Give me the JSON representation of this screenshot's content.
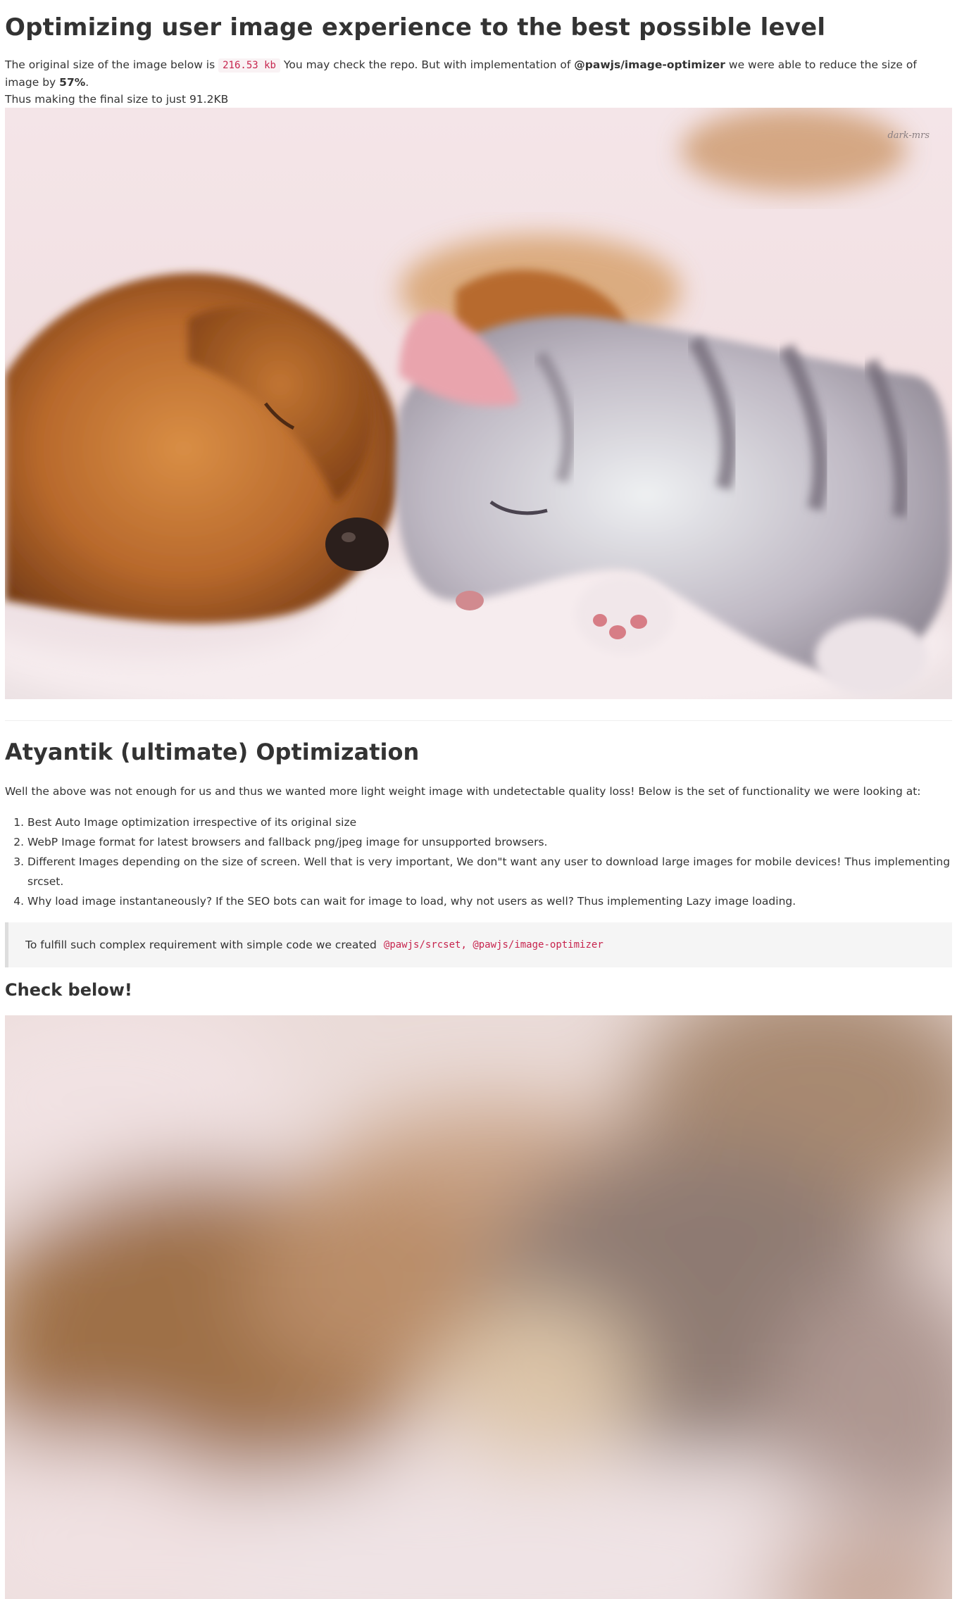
{
  "header": {
    "title": "Optimizing user image experience to the best possible level"
  },
  "intro": {
    "part1": "The original size of the image below is",
    "original_size": "216.53 kb",
    "part2": "You may check the repo. But with implementation of",
    "package": "@pawjs/image-optimizer",
    "part3": "we were able to reduce the size of image by",
    "reduction": "57%",
    "part4": ".",
    "part5": "Thus making the final size to just 91.2KB"
  },
  "hero_image": {
    "alt": "puppy and kitten sleeping",
    "watermark": "dark-mrs"
  },
  "section": {
    "title": "Atyantik (ultimate) Optimization",
    "description": "Well the above was not enough for us and thus we wanted more light weight image with undetectable quality loss! Below is the set of functionality we were looking at:",
    "features": [
      "Best Auto Image optimization irrespective of its original size",
      "WebP Image format for latest browsers and fallback png/jpeg image for unsupported browsers.",
      "Different Images depending on the size of screen. Well that is very important, We don\"t want any user to download large images for mobile devices! Thus implementing srcset.",
      "Why load image instantaneously? If the SEO bots can wait for image to load, why not users as well? Thus implementing Lazy image loading."
    ]
  },
  "blockquote": {
    "text": "To fulfill such complex requirement with simple code we created",
    "code": "@pawjs/srcset, @pawjs/image-optimizer"
  },
  "check": {
    "title": "Check below!"
  },
  "colors": {
    "text": "#333333",
    "code": "#c7254e",
    "code_bg": "#f9f2f4",
    "quote_bg": "#f5f5f5",
    "quote_border": "#dddddd"
  }
}
